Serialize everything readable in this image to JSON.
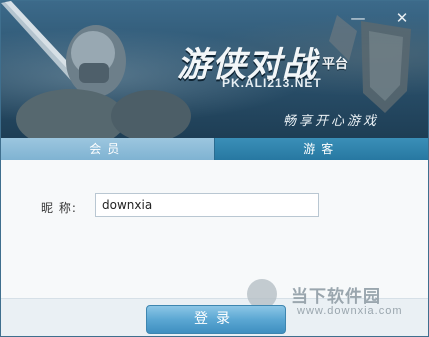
{
  "banner": {
    "title": "游侠对战",
    "title_suffix": "平台",
    "site": "PK.ALI213.NET",
    "slogan": "畅享开心游戏"
  },
  "window_controls": {
    "minimize": "—",
    "close": "✕"
  },
  "tabs": [
    {
      "label": "会员",
      "active": false
    },
    {
      "label": "游客",
      "active": true
    }
  ],
  "form": {
    "nickname_label": "昵  称:",
    "nickname_value": "downxia"
  },
  "login_button": "登录",
  "watermark": {
    "name": "当下软件园",
    "url": "www.downxia.com"
  },
  "icons": {
    "banner_art": "warrior-with-sword-and-shield",
    "watermark_logo": "downxia-logo-icon"
  }
}
